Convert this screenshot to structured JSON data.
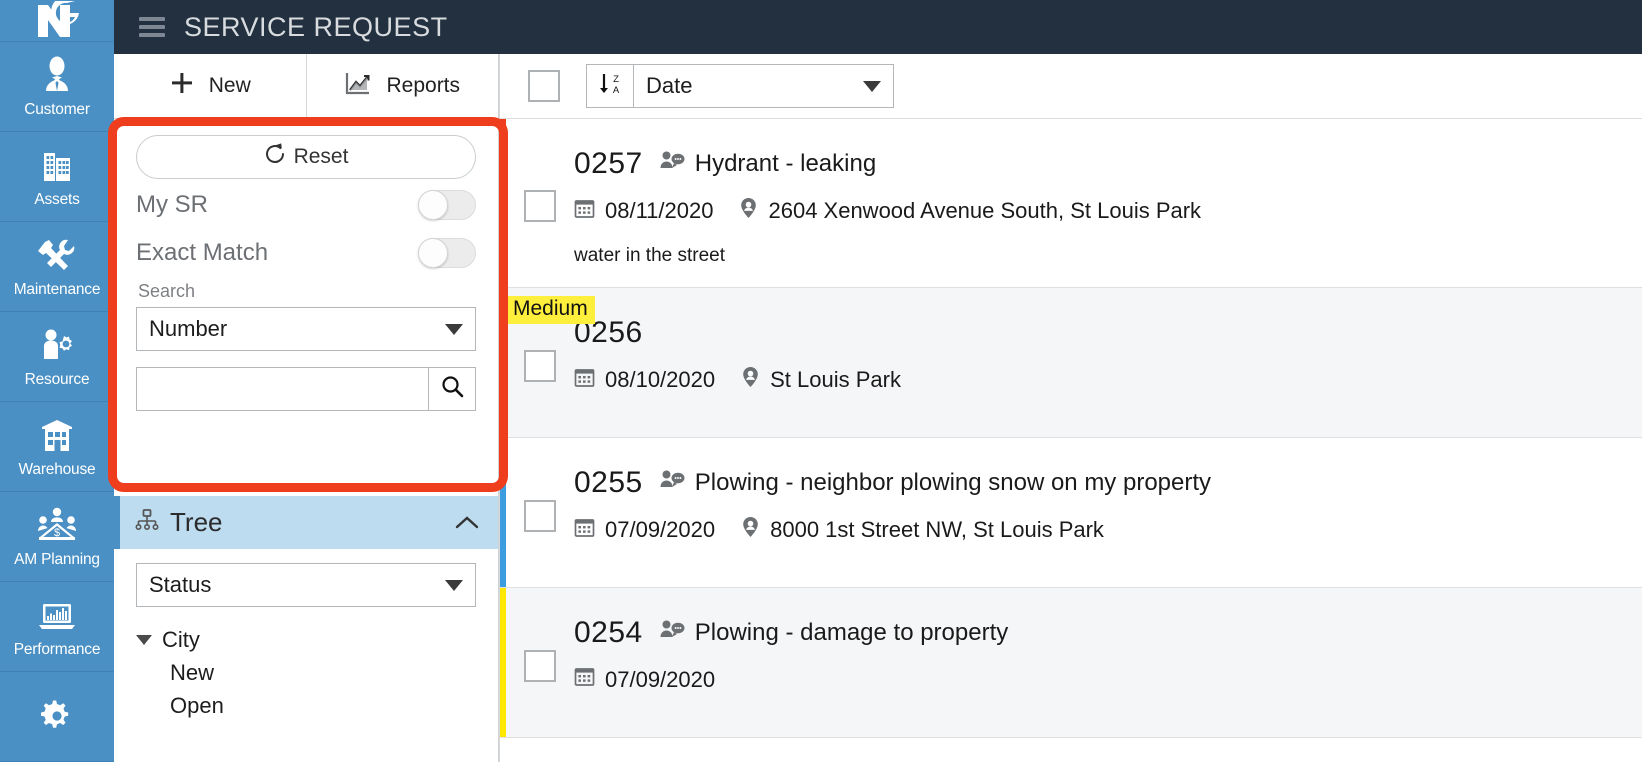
{
  "app": {
    "logo_text": "NG",
    "logo_icon": "ng-monogram-logo"
  },
  "nav": {
    "items": [
      {
        "label": "Customer",
        "icon": "user-tie-icon"
      },
      {
        "label": "Assets",
        "icon": "building-icon"
      },
      {
        "label": "Maintenance",
        "icon": "wrench-screwdriver-icon"
      },
      {
        "label": "Resource",
        "icon": "person-gear-icon"
      },
      {
        "label": "Warehouse",
        "icon": "warehouse-icon"
      },
      {
        "label": "AM Planning",
        "icon": "people-table-money-icon"
      },
      {
        "label": "Performance",
        "icon": "laptop-chart-icon"
      },
      {
        "label": "",
        "icon": "gear-icon"
      }
    ]
  },
  "topbar": {
    "menu_icon": "hamburger-menu-icon",
    "title": "SERVICE REQUEST"
  },
  "toolbar": {
    "new_label": "New",
    "new_icon": "plus-icon",
    "reports_label": "Reports",
    "reports_icon": "chart-line-icon"
  },
  "filter": {
    "reset_label": "Reset",
    "reset_icon": "refresh-icon",
    "my_sr_label": "My SR",
    "my_sr_on": false,
    "exact_match_label": "Exact Match",
    "exact_match_on": false,
    "search_section_label": "Search",
    "search_field_selected": "Number",
    "search_value": "",
    "search_placeholder": "",
    "search_icon": "search-icon"
  },
  "tree": {
    "title": "Tree",
    "icon": "sitemap-icon",
    "collapse_icon": "chevron-up-icon",
    "group_by_selected": "Status",
    "nodes": [
      {
        "label": "City",
        "level": 0,
        "expanded": true
      },
      {
        "label": "New",
        "level": 1,
        "expanded": null
      },
      {
        "label": "Open",
        "level": 1,
        "expanded": null
      }
    ]
  },
  "list": {
    "select_all_checked": false,
    "sort_icon": "sort-desc-za-icon",
    "sort_field": "Date",
    "rows": [
      {
        "number": "0257",
        "type": "Hydrant - leaking",
        "type_icon": "person-comment-icon",
        "date": "08/11/2020",
        "date_icon": "calendar-icon",
        "location": "2604 Xenwood Avenue South, St Louis Park",
        "location_icon": "map-marker-icon",
        "description": "water in the street",
        "priority": "",
        "stripe_color": "#ee3e1e",
        "shaded": false,
        "checked": false
      },
      {
        "number": "0256",
        "type": "",
        "type_icon": "",
        "date": "08/10/2020",
        "date_icon": "calendar-icon",
        "location": "St Louis Park",
        "location_icon": "map-marker-icon",
        "description": "",
        "priority": "Medium",
        "stripe_color": "#ffe800",
        "shaded": true,
        "checked": false
      },
      {
        "number": "0255",
        "type": "Plowing - neighbor plowing snow on my property",
        "type_icon": "person-comment-icon",
        "date": "07/09/2020",
        "date_icon": "calendar-icon",
        "location": "8000 1st Street NW, St Louis Park",
        "location_icon": "map-marker-icon",
        "description": "",
        "priority": "",
        "stripe_color": "#3b9ce0",
        "shaded": false,
        "checked": false
      },
      {
        "number": "0254",
        "type": "Plowing - damage to property",
        "type_icon": "person-comment-icon",
        "date": "07/09/2020",
        "date_icon": "calendar-icon",
        "location": "",
        "location_icon": "",
        "description": "",
        "priority": "",
        "stripe_color": "#ffe800",
        "shaded": true,
        "checked": false
      }
    ]
  },
  "annotation": {
    "highlight_color": "#ee3e1e",
    "target": "filter-panel"
  },
  "colors": {
    "nav_blue": "#4a90c4",
    "topbar_dark": "#22303f",
    "tree_header": "#bddcf0",
    "priority_medium": "#ffef3d",
    "accent_red": "#ee3e1e"
  }
}
